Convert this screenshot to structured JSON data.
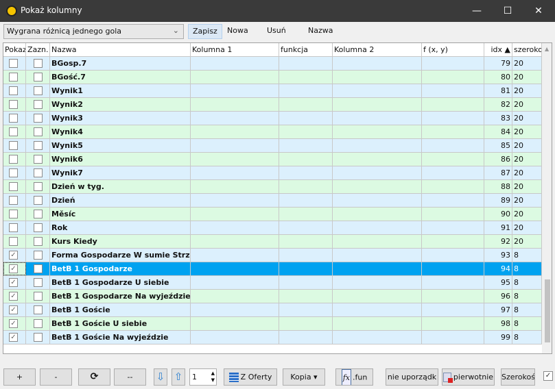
{
  "window": {
    "title": "Pokaż kolumny",
    "minimize": "—",
    "maximize": "☐",
    "close": "✕"
  },
  "toolbar": {
    "preset": "Wygrana różnicą jednego gola",
    "save": "Zapisz",
    "new": "Nowa",
    "delete": "Usuń",
    "name": "Nazwa"
  },
  "columns": [
    "Pokaz",
    "Zazn.",
    "Nazwa",
    "Kolumna 1",
    "funkcja",
    "Kolumna 2",
    "f (x, y)",
    "idx ▲",
    "szerokość"
  ],
  "rows": [
    {
      "show": false,
      "sel": false,
      "name": "BGosp.7",
      "idx": "79",
      "width": "20"
    },
    {
      "show": false,
      "sel": false,
      "name": "BGość.7",
      "idx": "80",
      "width": "20"
    },
    {
      "show": false,
      "sel": false,
      "name": "Wynik1",
      "idx": "81",
      "width": "20"
    },
    {
      "show": false,
      "sel": false,
      "name": "Wynik2",
      "idx": "82",
      "width": "20"
    },
    {
      "show": false,
      "sel": false,
      "name": "Wynik3",
      "idx": "83",
      "width": "20"
    },
    {
      "show": false,
      "sel": false,
      "name": "Wynik4",
      "idx": "84",
      "width": "20"
    },
    {
      "show": false,
      "sel": false,
      "name": "Wynik5",
      "idx": "85",
      "width": "20"
    },
    {
      "show": false,
      "sel": false,
      "name": "Wynik6",
      "idx": "86",
      "width": "20"
    },
    {
      "show": false,
      "sel": false,
      "name": "Wynik7",
      "idx": "87",
      "width": "20"
    },
    {
      "show": false,
      "sel": false,
      "name": "Dzień w tyg.",
      "idx": "88",
      "width": "20"
    },
    {
      "show": false,
      "sel": false,
      "name": "Dzień",
      "idx": "89",
      "width": "20"
    },
    {
      "show": false,
      "sel": false,
      "name": "Měsíc",
      "idx": "90",
      "width": "20"
    },
    {
      "show": false,
      "sel": false,
      "name": "Rok",
      "idx": "91",
      "width": "20"
    },
    {
      "show": false,
      "sel": false,
      "name": "Kurs Kiedy",
      "idx": "92",
      "width": "20"
    },
    {
      "show": true,
      "sel": false,
      "name": "Forma Gospodarze W sumie Strzeli",
      "idx": "93",
      "width": "8"
    },
    {
      "show": true,
      "sel": false,
      "name": "BetB 1 Gospodarze",
      "idx": "94",
      "width": "8",
      "selected": true
    },
    {
      "show": true,
      "sel": false,
      "name": "BetB 1 Gospodarze U siebie",
      "idx": "95",
      "width": "8"
    },
    {
      "show": true,
      "sel": false,
      "name": "BetB 1 Gospodarze Na wyjeździe",
      "idx": "96",
      "width": "8"
    },
    {
      "show": true,
      "sel": false,
      "name": "BetB 1 Goście",
      "idx": "97",
      "width": "8"
    },
    {
      "show": true,
      "sel": false,
      "name": "BetB 1 Goście U siebie",
      "idx": "98",
      "width": "8"
    },
    {
      "show": true,
      "sel": false,
      "name": "BetB 1 Goście Na wyjeździe",
      "idx": "99",
      "width": "8"
    }
  ],
  "bottom": {
    "plus": "+",
    "minus": "-",
    "refresh": "⟳",
    "dashdash": "--",
    "down": "⇩",
    "up": "⇧",
    "step": "1",
    "from_offers": "Z Oferty",
    "copy": "Kopia ▾",
    "fun": ".fun",
    "unordered": "nie uporządk",
    "original": "pierwotnie",
    "width": "Szerokość",
    "checkbox": "✓"
  },
  "colors": {
    "row_a": "#dcf0fd",
    "row_b": "#dcfae2",
    "selected": "#00a2f0"
  }
}
